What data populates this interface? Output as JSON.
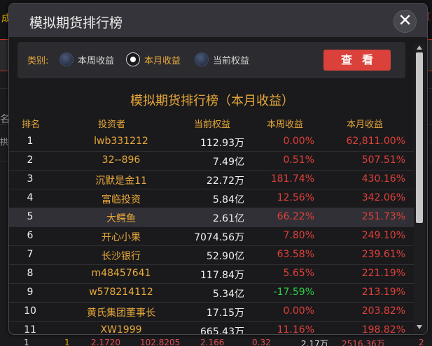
{
  "modal": {
    "title": "模拟期货排行榜",
    "close_label": "✕"
  },
  "filter": {
    "label": "类别:",
    "options": [
      {
        "label": "本周收益",
        "selected": false
      },
      {
        "label": "本月收益",
        "selected": true
      },
      {
        "label": "当前权益",
        "selected": false
      }
    ],
    "view_button": "查看"
  },
  "table": {
    "title": "模拟期货排行榜（本月收益）",
    "headers": [
      "排名",
      "投资者",
      "当前权益",
      "本周收益",
      "本月收益"
    ],
    "rows": [
      {
        "rank": "1",
        "name": "lwb331212",
        "equity": "112.93万",
        "week": "0.00%",
        "month": "62,811.00%"
      },
      {
        "rank": "2",
        "name": "32--896",
        "equity": "7.49亿",
        "week": "0.51%",
        "month": "507.51%"
      },
      {
        "rank": "3",
        "name": "沉默是金11",
        "equity": "22.72万",
        "week": "181.74%",
        "month": "430.16%"
      },
      {
        "rank": "4",
        "name": "富临投资",
        "equity": "5.84亿",
        "week": "12.56%",
        "month": "342.06%"
      },
      {
        "rank": "5",
        "name": "大鳄鱼",
        "equity": "2.61亿",
        "week": "66.22%",
        "month": "251.73%"
      },
      {
        "rank": "6",
        "name": "开心小果",
        "equity": "7074.56万",
        "week": "7.80%",
        "month": "249.10%"
      },
      {
        "rank": "7",
        "name": "长沙银行",
        "equity": "52.90亿",
        "week": "63.58%",
        "month": "239.61%"
      },
      {
        "rank": "8",
        "name": "m48457641",
        "equity": "117.84万",
        "week": "5.65%",
        "month": "221.19%"
      },
      {
        "rank": "9",
        "name": "w578214112",
        "equity": "5.34亿",
        "week": "-17.59%",
        "month": "213.19%"
      },
      {
        "rank": "10",
        "name": "黄氏集团董事长",
        "equity": "17.15万",
        "week": "0.00%",
        "month": "203.82%"
      },
      {
        "rank": "11",
        "name": "XW1999",
        "equity": "665.43万",
        "week": "11.16%",
        "month": "198.82%"
      }
    ]
  },
  "background": {
    "left_glyph": "成",
    "right_glyph": "(",
    "left_label": "名",
    "left_label2": "拱",
    "bottom_row": [
      "1",
      "1",
      "2.1720",
      "102.8205",
      "2.166",
      "0.32",
      "2.17万",
      "2516.36万",
      "2"
    ]
  },
  "colors": {
    "accent": "#e8a83a",
    "positive": "#e0403a",
    "negative": "#2fcf4a",
    "button": "#d9413a"
  }
}
